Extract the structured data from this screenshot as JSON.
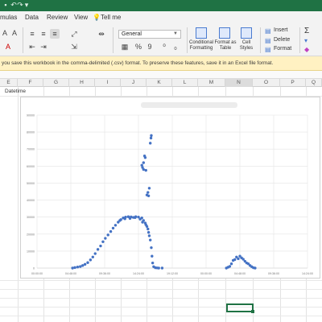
{
  "menu": {
    "items": [
      "mulas",
      "Data",
      "Review",
      "View",
      "Tell me"
    ]
  },
  "ribbon": {
    "number_format": "General",
    "conditional_formatting": "Conditional Formatting",
    "format_as_table": "Format as Table",
    "cell_styles": "Cell Styles",
    "insert": "Insert",
    "delete": "Delete",
    "format": "Format",
    "percent": "%",
    "comma": "9"
  },
  "warning": {
    "text": "you save this workbook in the comma-delimited (.csv) format. To preserve these features, save it in an Excel file format."
  },
  "columns": [
    "E",
    "F",
    "G",
    "H",
    "I",
    "J",
    "K",
    "L",
    "M",
    "N",
    "O",
    "P",
    "Q"
  ],
  "cell_a1": "Datetime",
  "chart_data": {
    "type": "scatter",
    "title": "",
    "ylim": [
      0,
      90000
    ],
    "yticks": [
      "0",
      "10000",
      "20000",
      "30000",
      "40000",
      "50000",
      "60000",
      "70000",
      "80000",
      "90000"
    ],
    "xticks": [
      "00:00:00",
      "04:48:00",
      "09:36:00",
      "14:24:00",
      "19:12:00",
      "00:00:00",
      "04:48:00",
      "09:36:00",
      "14:24:00"
    ],
    "xlim": [
      0,
      8
    ],
    "color": "#4472c4",
    "points": [
      [
        1.05,
        0
      ],
      [
        1.12,
        300
      ],
      [
        1.2,
        600
      ],
      [
        1.28,
        900
      ],
      [
        1.35,
        1500
      ],
      [
        1.42,
        2200
      ],
      [
        1.5,
        3200
      ],
      [
        1.58,
        4800
      ],
      [
        1.65,
        6500
      ],
      [
        1.72,
        8500
      ],
      [
        1.8,
        11000
      ],
      [
        1.88,
        13000
      ],
      [
        1.95,
        15500
      ],
      [
        2.02,
        17500
      ],
      [
        2.1,
        19500
      ],
      [
        2.18,
        21500
      ],
      [
        2.25,
        23500
      ],
      [
        2.32,
        25200
      ],
      [
        2.4,
        27000
      ],
      [
        2.48,
        28500
      ],
      [
        2.55,
        29500
      ],
      [
        2.62,
        30000
      ],
      [
        2.7,
        30200
      ],
      [
        2.78,
        30100
      ],
      [
        2.85,
        29800
      ],
      [
        2.92,
        30200
      ],
      [
        3.0,
        30000
      ],
      [
        3.05,
        28800
      ],
      [
        3.1,
        29500
      ],
      [
        3.15,
        28000
      ],
      [
        3.2,
        26500
      ],
      [
        3.25,
        24500
      ],
      [
        3.3,
        21000
      ],
      [
        3.35,
        16500
      ],
      [
        3.38,
        12000
      ],
      [
        3.4,
        7000
      ],
      [
        3.42,
        3000
      ],
      [
        3.45,
        800
      ],
      [
        3.5,
        200
      ],
      [
        3.55,
        100
      ],
      [
        3.6,
        0
      ],
      [
        3.7,
        0
      ],
      [
        2.45,
        28000
      ],
      [
        2.6,
        29000
      ],
      [
        2.75,
        29200
      ],
      [
        2.9,
        29700
      ],
      [
        3.12,
        27000
      ],
      [
        3.22,
        25500
      ],
      [
        3.28,
        23000
      ],
      [
        3.32,
        19000
      ],
      [
        3.1,
        60500
      ],
      [
        3.12,
        59200
      ],
      [
        3.15,
        62000
      ],
      [
        3.18,
        66000
      ],
      [
        3.2,
        65000
      ],
      [
        3.15,
        58000
      ],
      [
        3.22,
        57500
      ],
      [
        3.25,
        43000
      ],
      [
        3.28,
        44500
      ],
      [
        3.32,
        47000
      ],
      [
        3.35,
        73500
      ],
      [
        3.37,
        76500
      ],
      [
        3.38,
        78000
      ],
      [
        3.3,
        42500
      ],
      [
        5.6,
        0
      ],
      [
        5.65,
        500
      ],
      [
        5.7,
        1000
      ],
      [
        5.75,
        2500
      ],
      [
        5.8,
        4500
      ],
      [
        5.85,
        5000
      ],
      [
        5.9,
        6500
      ],
      [
        5.95,
        5500
      ],
      [
        6.0,
        7000
      ],
      [
        6.05,
        6000
      ],
      [
        6.1,
        5200
      ],
      [
        6.15,
        4000
      ],
      [
        6.2,
        3000
      ],
      [
        6.25,
        2500
      ],
      [
        6.3,
        1500
      ],
      [
        6.35,
        800
      ],
      [
        6.4,
        200
      ],
      [
        6.45,
        0
      ]
    ]
  }
}
